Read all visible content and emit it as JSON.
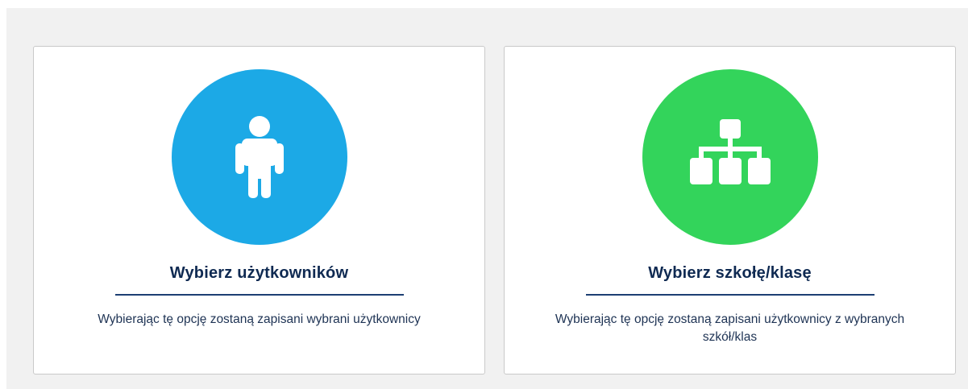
{
  "options": [
    {
      "title": "Wybierz użytkowników",
      "description": "Wybierając tę opcję zostaną zapisani wybrani użytkownicy",
      "icon": "user-icon",
      "color": "#1ca9e6"
    },
    {
      "title": "Wybierz szkołę/klasę",
      "description": "Wybierając tę opcję zostaną zapisani użytkownicy z wybranych szkół/klas",
      "icon": "hierarchy-icon",
      "color": "#33d45b"
    }
  ]
}
